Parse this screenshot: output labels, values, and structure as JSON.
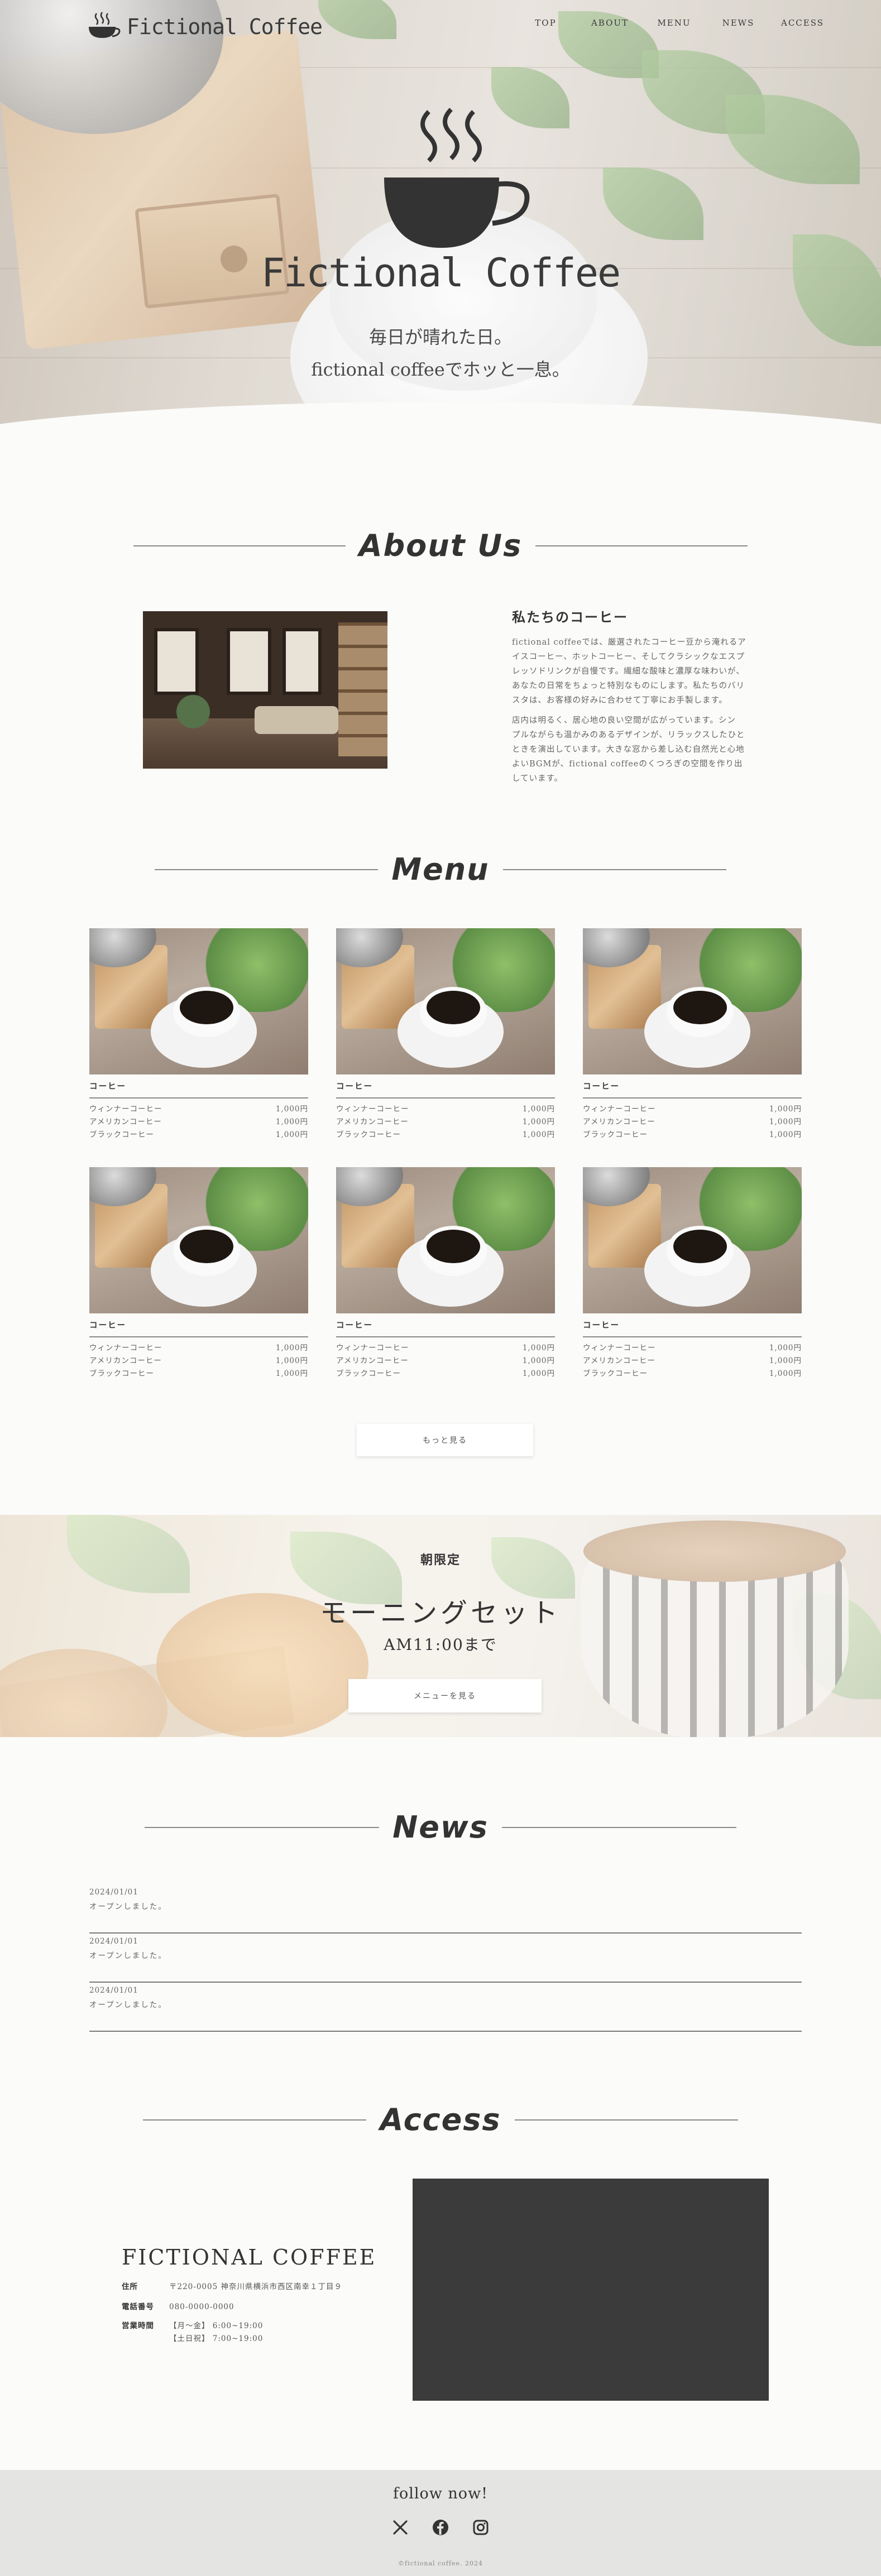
{
  "brand": {
    "name": "Fictional Coffee"
  },
  "nav": [
    {
      "label": "TOP"
    },
    {
      "label": "ABOUT"
    },
    {
      "label": "MENU"
    },
    {
      "label": "NEWS"
    },
    {
      "label": "ACCESS"
    }
  ],
  "hero": {
    "title": "Fictional Coffee",
    "sub_line1": "毎日が晴れた日。",
    "sub_line2": "fictional coffeeでホッと一息。"
  },
  "about": {
    "heading": "About Us",
    "subheading": "私たちのコーヒー",
    "p1_lines": [
      "fictional coffeeでは、厳選されたコーヒー豆から淹れるア",
      "イスコーヒー、ホットコーヒー、そしてクラシックなエスプ",
      "レッソドリンクが自慢です。繊細な酸味と濃厚な味わいが、",
      "あなたの日常をちょっと特別なものにします。私たちのバリ",
      "スタは、お客様の好みに合わせて丁寧にお手製します。"
    ],
    "p2_lines": [
      "店内は明るく、居心地の良い空間が広がっています。シン",
      "プルながらも温かみのあるデザインが、リラックスしたひと",
      "ときを演出しています。大きな窓から差し込む自然光と心地",
      "よいBGMが、fictional coffeeのくつろぎの空間を作り出",
      "しています。"
    ]
  },
  "menu": {
    "heading": "Menu",
    "cards": [
      {
        "category": "コーヒー",
        "items": [
          {
            "name": "ウィンナーコーヒー",
            "price": "1,000円"
          },
          {
            "name": "アメリカンコーヒー",
            "price": "1,000円"
          },
          {
            "name": "ブラックコーヒー",
            "price": "1,000円"
          }
        ]
      },
      {
        "category": "コーヒー",
        "items": [
          {
            "name": "ウィンナーコーヒー",
            "price": "1,000円"
          },
          {
            "name": "アメリカンコーヒー",
            "price": "1,000円"
          },
          {
            "name": "ブラックコーヒー",
            "price": "1,000円"
          }
        ]
      },
      {
        "category": "コーヒー",
        "items": [
          {
            "name": "ウィンナーコーヒー",
            "price": "1,000円"
          },
          {
            "name": "アメリカンコーヒー",
            "price": "1,000円"
          },
          {
            "name": "ブラックコーヒー",
            "price": "1,000円"
          }
        ]
      },
      {
        "category": "コーヒー",
        "items": [
          {
            "name": "ウィンナーコーヒー",
            "price": "1,000円"
          },
          {
            "name": "アメリカンコーヒー",
            "price": "1,000円"
          },
          {
            "name": "ブラックコーヒー",
            "price": "1,000円"
          }
        ]
      },
      {
        "category": "コーヒー",
        "items": [
          {
            "name": "ウィンナーコーヒー",
            "price": "1,000円"
          },
          {
            "name": "アメリカンコーヒー",
            "price": "1,000円"
          },
          {
            "name": "ブラックコーヒー",
            "price": "1,000円"
          }
        ]
      },
      {
        "category": "コーヒー",
        "items": [
          {
            "name": "ウィンナーコーヒー",
            "price": "1,000円"
          },
          {
            "name": "アメリカンコーヒー",
            "price": "1,000円"
          },
          {
            "name": "ブラックコーヒー",
            "price": "1,000円"
          }
        ]
      }
    ],
    "more_label": "もっと見る"
  },
  "morning": {
    "label": "朝限定",
    "title": "モーニングセット",
    "time": "AM11:00まで",
    "button": "メニューを見る"
  },
  "news": {
    "heading": "News",
    "items": [
      {
        "date": "2024/01/01",
        "text": "オープンしました。"
      },
      {
        "date": "2024/01/01",
        "text": "オープンしました。"
      },
      {
        "date": "2024/01/01",
        "text": "オープンしました。"
      }
    ]
  },
  "access": {
    "heading": "Access",
    "name": "FICTIONAL COFFEE",
    "address_label": "住所",
    "address": "〒220-0005 神奈川県横浜市西区南幸１丁目９",
    "phone_label": "電話番号",
    "phone": "080-0000-0000",
    "hours_label": "営業時間",
    "hours1": "【月～金】 6:00~19:00",
    "hours2": "【土日祝】 7:00~19:00"
  },
  "footer": {
    "follow": "follow now!",
    "social_icons": [
      "x-icon",
      "facebook-icon",
      "instagram-icon"
    ],
    "copyright": "©fictional coffee. 2024"
  }
}
